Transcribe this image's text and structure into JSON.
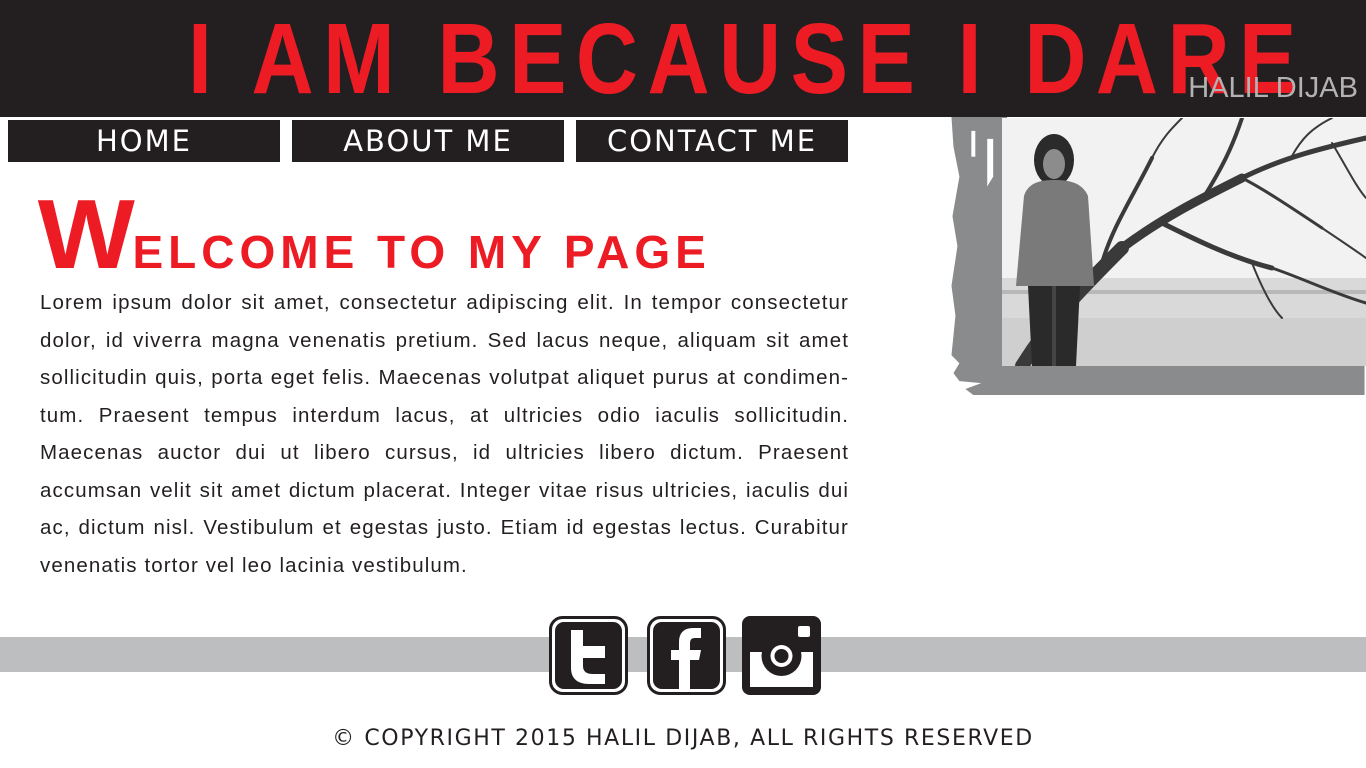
{
  "header": {
    "title": "I AM BECAUSE I DARE",
    "author": "HALIL DIJAB"
  },
  "nav": {
    "items": [
      {
        "label": "HOME"
      },
      {
        "label": "ABOUT ME"
      },
      {
        "label": "CONTACT ME"
      }
    ]
  },
  "welcome": {
    "initial": "W",
    "rest": "ELCOME TO MY PAGE"
  },
  "intro": "Lorem ipsum dolor sit amet, consectetur adipiscing elit. In tempor consectetur dolor, id viverra magna venenatis pretium. Sed lacus neque, aliquam sit amet sollicitudin quis, porta eget felis. Maecenas volutpat aliquet purus at condimen-tum. Praesent tempus interdum lacus, at ultricies odio iaculis sollicitudin. Maecenas auctor dui ut libero cursus, id ultricies libero dictum. Praesent accumsan velit sit amet dictum placerat. Integer vitae risus ultricies, iaculis dui ac, dictum nisl. Vestibulum et egestas justo. Etiam id egestas lectus. Curabitur venenatis tortor vel leo lacinia vestibulum.",
  "social": [
    {
      "icon": "twitter-icon"
    },
    {
      "icon": "facebook-icon"
    },
    {
      "icon": "instagram-icon"
    }
  ],
  "footer": {
    "copyright": "© COPYRIGHT 2015 HALIL DIJAB, ALL RIGHTS RESERVED"
  },
  "colors": {
    "header_bg": "#231f20",
    "accent": "#ed1c24",
    "footer_band": "#bcbec0"
  }
}
